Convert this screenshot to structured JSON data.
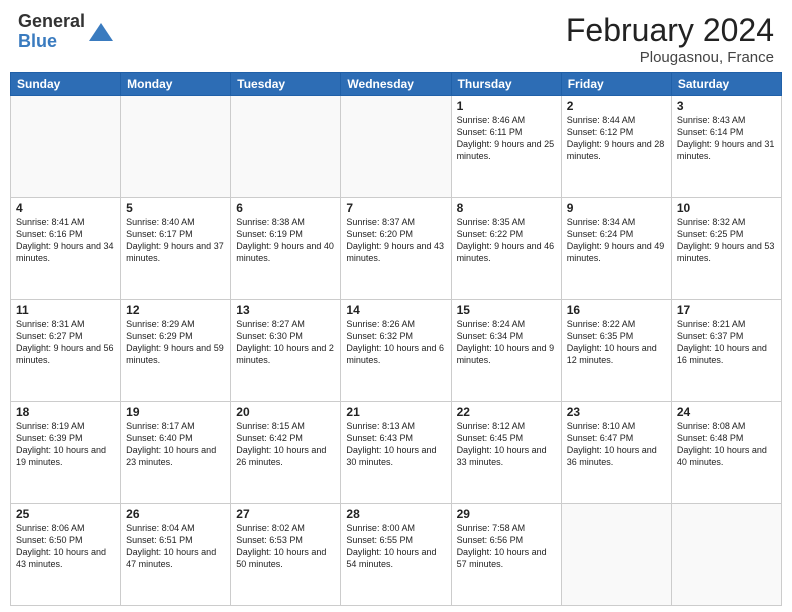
{
  "header": {
    "logo_general": "General",
    "logo_blue": "Blue",
    "month_year": "February 2024",
    "location": "Plougasnou, France"
  },
  "days_of_week": [
    "Sunday",
    "Monday",
    "Tuesday",
    "Wednesday",
    "Thursday",
    "Friday",
    "Saturday"
  ],
  "weeks": [
    [
      {
        "num": "",
        "info": ""
      },
      {
        "num": "",
        "info": ""
      },
      {
        "num": "",
        "info": ""
      },
      {
        "num": "",
        "info": ""
      },
      {
        "num": "1",
        "info": "Sunrise: 8:46 AM\nSunset: 6:11 PM\nDaylight: 9 hours and 25 minutes."
      },
      {
        "num": "2",
        "info": "Sunrise: 8:44 AM\nSunset: 6:12 PM\nDaylight: 9 hours and 28 minutes."
      },
      {
        "num": "3",
        "info": "Sunrise: 8:43 AM\nSunset: 6:14 PM\nDaylight: 9 hours and 31 minutes."
      }
    ],
    [
      {
        "num": "4",
        "info": "Sunrise: 8:41 AM\nSunset: 6:16 PM\nDaylight: 9 hours and 34 minutes."
      },
      {
        "num": "5",
        "info": "Sunrise: 8:40 AM\nSunset: 6:17 PM\nDaylight: 9 hours and 37 minutes."
      },
      {
        "num": "6",
        "info": "Sunrise: 8:38 AM\nSunset: 6:19 PM\nDaylight: 9 hours and 40 minutes."
      },
      {
        "num": "7",
        "info": "Sunrise: 8:37 AM\nSunset: 6:20 PM\nDaylight: 9 hours and 43 minutes."
      },
      {
        "num": "8",
        "info": "Sunrise: 8:35 AM\nSunset: 6:22 PM\nDaylight: 9 hours and 46 minutes."
      },
      {
        "num": "9",
        "info": "Sunrise: 8:34 AM\nSunset: 6:24 PM\nDaylight: 9 hours and 49 minutes."
      },
      {
        "num": "10",
        "info": "Sunrise: 8:32 AM\nSunset: 6:25 PM\nDaylight: 9 hours and 53 minutes."
      }
    ],
    [
      {
        "num": "11",
        "info": "Sunrise: 8:31 AM\nSunset: 6:27 PM\nDaylight: 9 hours and 56 minutes."
      },
      {
        "num": "12",
        "info": "Sunrise: 8:29 AM\nSunset: 6:29 PM\nDaylight: 9 hours and 59 minutes."
      },
      {
        "num": "13",
        "info": "Sunrise: 8:27 AM\nSunset: 6:30 PM\nDaylight: 10 hours and 2 minutes."
      },
      {
        "num": "14",
        "info": "Sunrise: 8:26 AM\nSunset: 6:32 PM\nDaylight: 10 hours and 6 minutes."
      },
      {
        "num": "15",
        "info": "Sunrise: 8:24 AM\nSunset: 6:34 PM\nDaylight: 10 hours and 9 minutes."
      },
      {
        "num": "16",
        "info": "Sunrise: 8:22 AM\nSunset: 6:35 PM\nDaylight: 10 hours and 12 minutes."
      },
      {
        "num": "17",
        "info": "Sunrise: 8:21 AM\nSunset: 6:37 PM\nDaylight: 10 hours and 16 minutes."
      }
    ],
    [
      {
        "num": "18",
        "info": "Sunrise: 8:19 AM\nSunset: 6:39 PM\nDaylight: 10 hours and 19 minutes."
      },
      {
        "num": "19",
        "info": "Sunrise: 8:17 AM\nSunset: 6:40 PM\nDaylight: 10 hours and 23 minutes."
      },
      {
        "num": "20",
        "info": "Sunrise: 8:15 AM\nSunset: 6:42 PM\nDaylight: 10 hours and 26 minutes."
      },
      {
        "num": "21",
        "info": "Sunrise: 8:13 AM\nSunset: 6:43 PM\nDaylight: 10 hours and 30 minutes."
      },
      {
        "num": "22",
        "info": "Sunrise: 8:12 AM\nSunset: 6:45 PM\nDaylight: 10 hours and 33 minutes."
      },
      {
        "num": "23",
        "info": "Sunrise: 8:10 AM\nSunset: 6:47 PM\nDaylight: 10 hours and 36 minutes."
      },
      {
        "num": "24",
        "info": "Sunrise: 8:08 AM\nSunset: 6:48 PM\nDaylight: 10 hours and 40 minutes."
      }
    ],
    [
      {
        "num": "25",
        "info": "Sunrise: 8:06 AM\nSunset: 6:50 PM\nDaylight: 10 hours and 43 minutes."
      },
      {
        "num": "26",
        "info": "Sunrise: 8:04 AM\nSunset: 6:51 PM\nDaylight: 10 hours and 47 minutes."
      },
      {
        "num": "27",
        "info": "Sunrise: 8:02 AM\nSunset: 6:53 PM\nDaylight: 10 hours and 50 minutes."
      },
      {
        "num": "28",
        "info": "Sunrise: 8:00 AM\nSunset: 6:55 PM\nDaylight: 10 hours and 54 minutes."
      },
      {
        "num": "29",
        "info": "Sunrise: 7:58 AM\nSunset: 6:56 PM\nDaylight: 10 hours and 57 minutes."
      },
      {
        "num": "",
        "info": ""
      },
      {
        "num": "",
        "info": ""
      }
    ]
  ]
}
